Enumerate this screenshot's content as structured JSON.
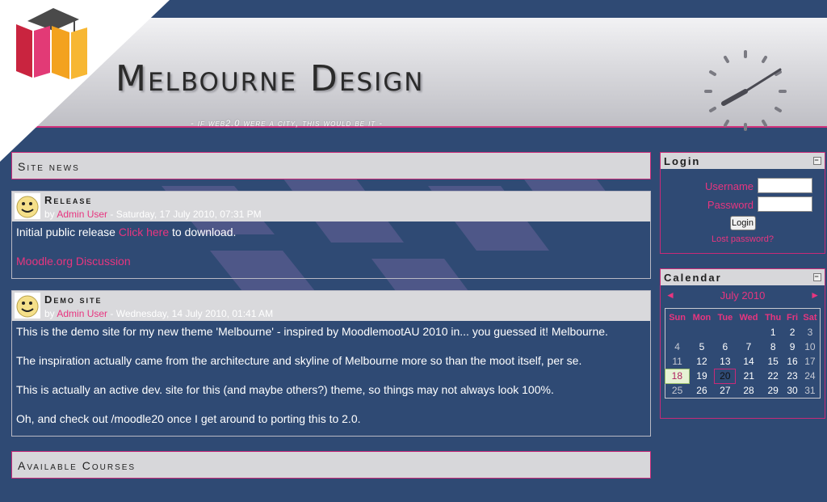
{
  "header": {
    "title": "Melbourne Design",
    "tagline": "- if web2.0 were a city, this would be it -"
  },
  "main": {
    "site_news_heading": "Site news",
    "posts": [
      {
        "subject": "Release",
        "by": "by",
        "author": "Admin User",
        "date": " - Saturday, 17 July 2010, 07:31 PM",
        "body_prefix": "Initial public release ",
        "body_link": "Click here",
        "body_suffix": " to download.",
        "discussion_link": "Moodle.org Discussion"
      },
      {
        "subject": "Demo site",
        "by": "by",
        "author": "Admin User",
        "date": " - Wednesday, 14 July 2010, 01:41 AM",
        "paragraphs": [
          "This is the demo site for my new theme 'Melbourne' - inspired by MoodlemootAU 2010 in... you guessed it! Melbourne.",
          "The inspiration actually came from the architecture and skyline of Melbourne more so than the moot itself, per se.",
          "This is actually an active dev. site for this (and maybe others?) theme, so things may not always look 100%.",
          "Oh, and check out /moodle20 once I get around to porting this to 2.0."
        ]
      }
    ],
    "courses_heading": "Available Courses"
  },
  "login": {
    "title": "Login",
    "collapse": "−",
    "username_label": "Username",
    "password_label": "Password",
    "button": "Login",
    "lost_password": "Lost password?"
  },
  "calendar": {
    "title": "Calendar",
    "collapse": "−",
    "month": "July 2010",
    "prev": "◄",
    "next": "►",
    "days": [
      "Sun",
      "Mon",
      "Tue",
      "Wed",
      "Thu",
      "Fri",
      "Sat"
    ],
    "weeks": [
      [
        "",
        "",
        "",
        "",
        "1",
        "2",
        "3"
      ],
      [
        "4",
        "5",
        "6",
        "7",
        "8",
        "9",
        "10"
      ],
      [
        "11",
        "12",
        "13",
        "14",
        "15",
        "16",
        "17"
      ],
      [
        "18",
        "19",
        "20",
        "21",
        "22",
        "23",
        "24"
      ],
      [
        "25",
        "26",
        "27",
        "28",
        "29",
        "30",
        "31"
      ]
    ],
    "event_day": "18",
    "today": "20"
  },
  "colors": {
    "background": "#2f4a74",
    "accent": "#e8357f",
    "header_gray": "#d7d7da"
  }
}
